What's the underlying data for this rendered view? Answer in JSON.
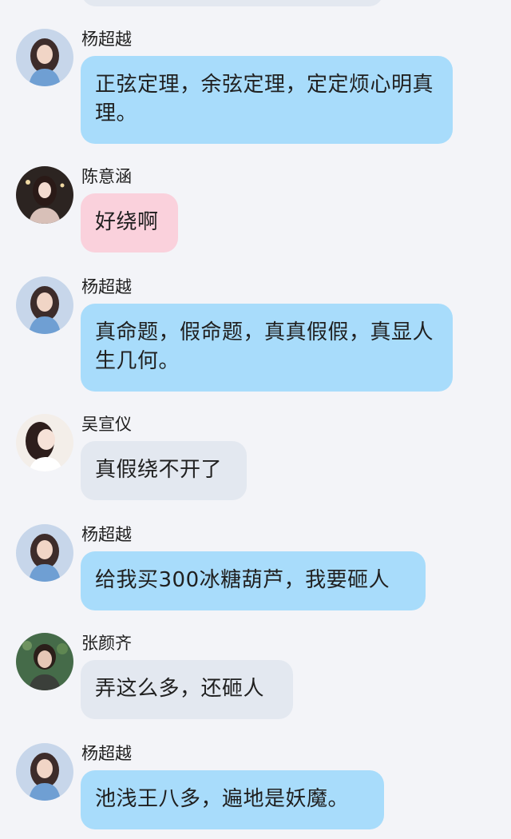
{
  "messages": [
    {
      "sender": "杨超越",
      "text": "正弦定理，余弦定理，定定烦心明真理。",
      "bubble": "blue",
      "avatar": "avatar-yang"
    },
    {
      "sender": "陈意涵",
      "text": "好绕啊",
      "bubble": "pink",
      "avatar": "avatar-chen"
    },
    {
      "sender": "杨超越",
      "text": "真命题，假命题，真真假假，真显人生几何。",
      "bubble": "blue",
      "avatar": "avatar-yang"
    },
    {
      "sender": "吴宣仪",
      "text": "真假绕不开了",
      "bubble": "gray",
      "avatar": "avatar-wu"
    },
    {
      "sender": "杨超越",
      "text": "给我买300冰糖葫芦，我要砸人",
      "bubble": "blue",
      "avatar": "avatar-yang"
    },
    {
      "sender": "张颜齐",
      "text": "弄这么多，还砸人",
      "bubble": "gray",
      "avatar": "avatar-zhang"
    },
    {
      "sender": "杨超越",
      "text": "池浅王八多，遍地是妖魔。",
      "bubble": "blue",
      "avatar": "avatar-yang"
    }
  ]
}
